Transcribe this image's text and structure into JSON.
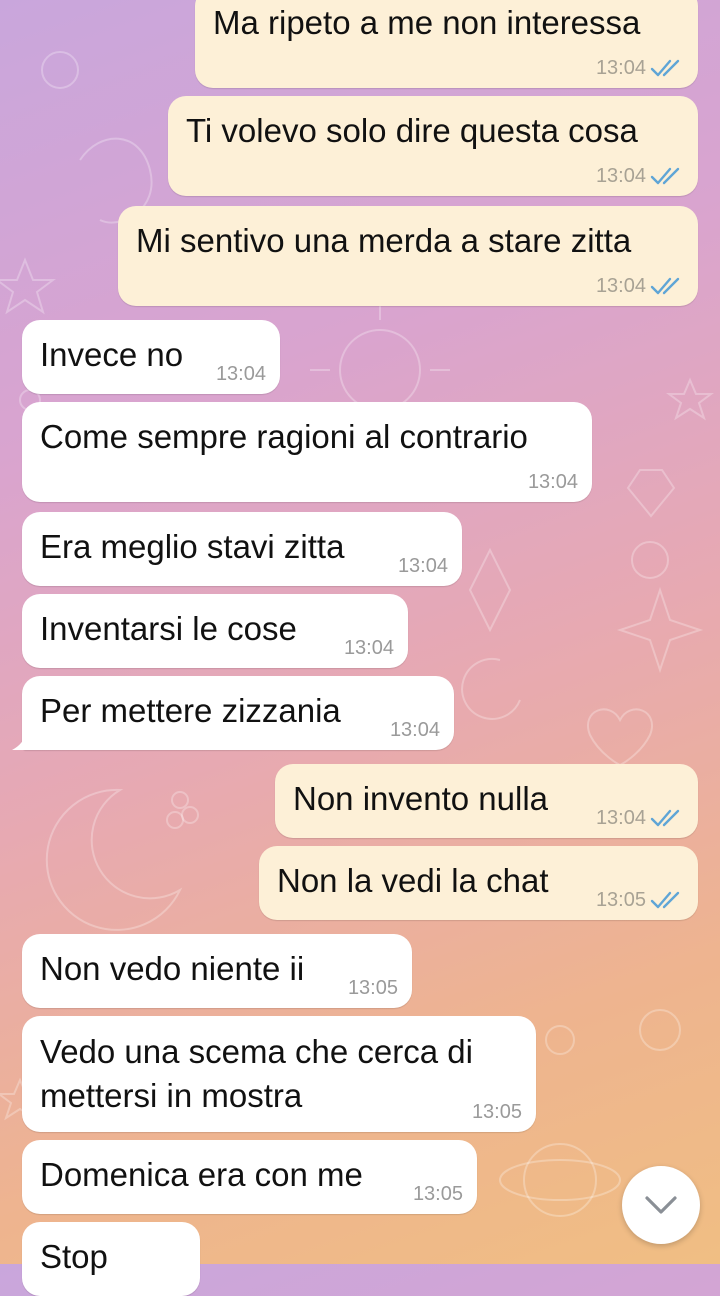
{
  "colors": {
    "incoming_bubble": "#ffffff",
    "outgoing_bubble": "#fdf0d7",
    "read_check": "#5fa5d6"
  },
  "messages": [
    {
      "dir": "out",
      "text": "Ma ripeto a me non interessa",
      "time": "13:04",
      "read": true
    },
    {
      "dir": "out",
      "text": "Ti volevo solo dire questa cosa",
      "time": "13:04",
      "read": true
    },
    {
      "dir": "out",
      "text": "Mi sentivo una merda a stare zitta",
      "time": "13:04",
      "read": true
    },
    {
      "dir": "in",
      "text": "Invece no",
      "time": "13:04"
    },
    {
      "dir": "in",
      "text": "Come sempre ragioni al contrario",
      "time": "13:04"
    },
    {
      "dir": "in",
      "text": "Era meglio stavi zitta",
      "time": "13:04"
    },
    {
      "dir": "in",
      "text": "Inventarsi le cose",
      "time": "13:04"
    },
    {
      "dir": "in",
      "text": "Per mettere zizzania",
      "time": "13:04"
    },
    {
      "dir": "out",
      "text": "Non invento nulla",
      "time": "13:04",
      "read": true
    },
    {
      "dir": "out",
      "text": "Non la vedi la chat",
      "time": "13:05",
      "read": true
    },
    {
      "dir": "in",
      "text": "Non vedo niente ii",
      "time": "13:05"
    },
    {
      "dir": "in",
      "text": "Vedo una scema che cerca di mettersi in mostra",
      "time": "13:05"
    },
    {
      "dir": "in",
      "text": "Domenica era con me",
      "time": "13:05"
    },
    {
      "dir": "in",
      "text": "Stop",
      "time": ""
    }
  ],
  "scroll_button": {
    "icon": "chevron-down-icon"
  }
}
